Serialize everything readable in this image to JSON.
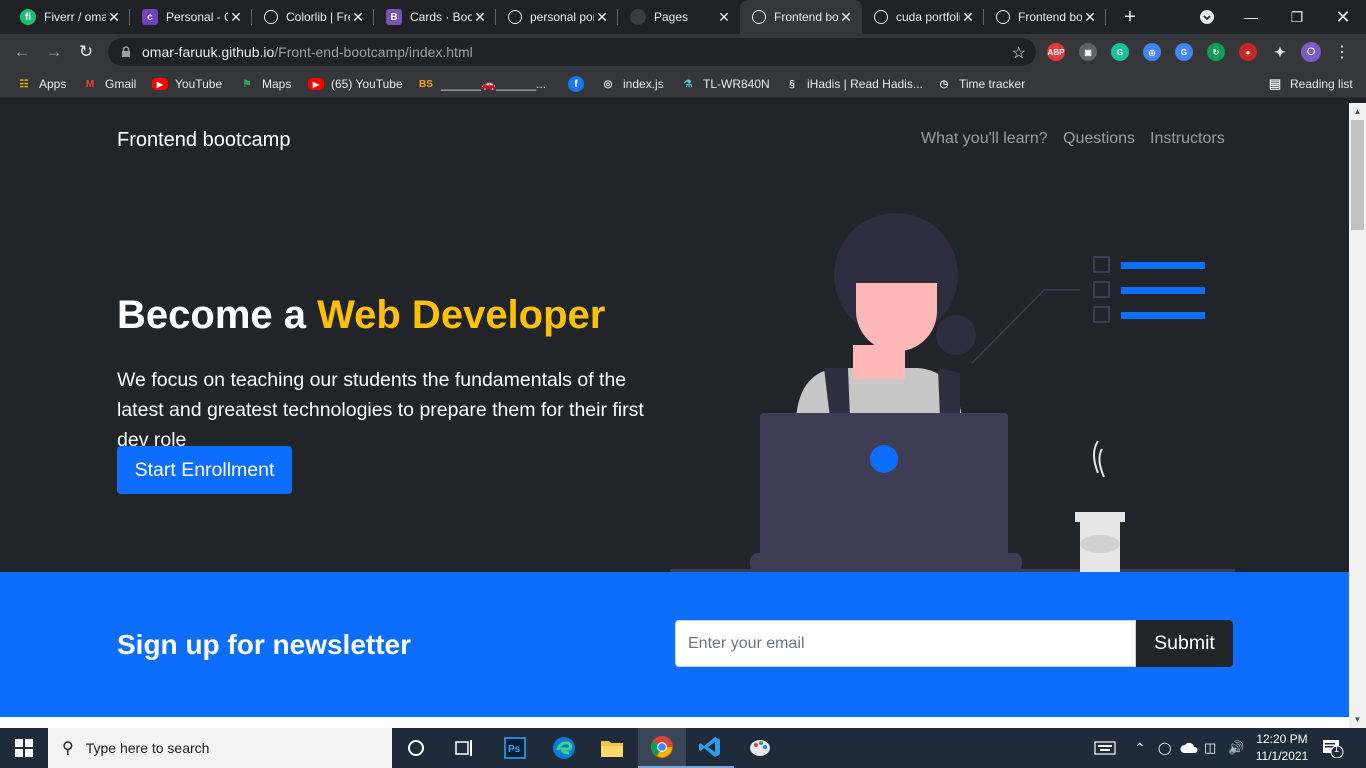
{
  "browser": {
    "tabs": [
      {
        "title": "Fiverr / omar",
        "favicon": "fiverr-icon",
        "color": "#1dbf73",
        "glyph": "fi"
      },
      {
        "title": "Personal - Colorlib",
        "favicon": "colorlib-icon",
        "color": "#6f42c1",
        "glyph": "c"
      },
      {
        "title": "Colorlib | Free",
        "favicon": "globe-icon",
        "color": "#e8eaed",
        "glyph": ""
      },
      {
        "title": "Cards · Bootstrap",
        "favicon": "bootstrap-icon",
        "color": "#7952b3",
        "glyph": "B"
      },
      {
        "title": "personal portfolio",
        "favicon": "globe-icon",
        "color": "#e8eaed",
        "glyph": ""
      },
      {
        "title": "Pages",
        "favicon": "github-icon",
        "color": "#e8eaed",
        "glyph": ""
      },
      {
        "title": "Frontend bootcamp",
        "favicon": "globe-icon",
        "color": "#e8eaed",
        "glyph": ""
      },
      {
        "title": "cuda portfolio",
        "favicon": "globe-icon",
        "color": "#e8eaed",
        "glyph": ""
      },
      {
        "title": "Frontend bootcamp",
        "favicon": "globe-icon",
        "color": "#e8eaed",
        "glyph": ""
      }
    ],
    "active_tab": 6,
    "url_host": "omar-faruuk.github.io",
    "url_path": "/Front-end-bootcamp/index.html",
    "bookmarks": [
      {
        "label": "Apps",
        "icon": "apps-grid-icon"
      },
      {
        "label": "Gmail",
        "icon": "gmail-icon"
      },
      {
        "label": "YouTube",
        "icon": "youtube-icon"
      },
      {
        "label": "Maps",
        "icon": "maps-icon"
      },
      {
        "label": "(65) YouTube",
        "icon": "youtube-icon"
      },
      {
        "label": "______🚗______...",
        "icon": "bs-icon"
      },
      {
        "label": "",
        "icon": "facebook-icon"
      },
      {
        "label": "index.js",
        "icon": "globe-icon"
      },
      {
        "label": "TL-WR840N",
        "icon": "tplink-icon"
      },
      {
        "label": "iHadis | Read Hadis...",
        "icon": "ihadis-icon"
      },
      {
        "label": "Time tracker",
        "icon": "clock-icon"
      }
    ],
    "reading_list": "Reading list",
    "profile_initial": "O",
    "extensions": [
      "adblock-icon",
      "camera-icon",
      "grammarly-icon",
      "extension-icon",
      "translate-icon",
      "refresh-ext-icon",
      "red-ext-icon",
      "puzzle-icon"
    ]
  },
  "site": {
    "brand": "Frontend bootcamp",
    "nav": [
      "What you'll learn?",
      "Questions",
      "Instructors"
    ],
    "hero": {
      "title_prefix": "Become a ",
      "title_highlight": "Web Developer",
      "text": "We focus on teaching our students the fundamentals of the latest and greatest technologies to prepare them for their first dev role",
      "cta": "Start Enrollment"
    },
    "newsletter": {
      "title": "Sign up for newsletter",
      "placeholder": "Enter your email",
      "button": "Submit"
    },
    "colors": {
      "accent": "#ffc107",
      "primary": "#0d6efd",
      "dark": "#212529"
    }
  },
  "taskbar": {
    "search_placeholder": "Type here to search",
    "apps": [
      "cortana-icon",
      "task-view-icon",
      "photoshop-icon",
      "edge-icon",
      "file-explorer-icon",
      "chrome-icon",
      "vscode-icon",
      "paint-icon"
    ],
    "time": "12:20 PM",
    "date": "11/1/2021",
    "notification_count": "1"
  }
}
